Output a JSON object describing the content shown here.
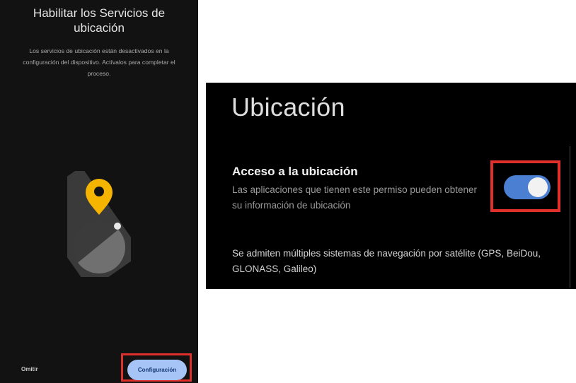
{
  "left_screen": {
    "title_line1": "Habilitar los Servicios de",
    "title_line2": "ubicación",
    "description": "Los servicios de ubicación están desactivados en la configuración del dispositivo. Actívalos para completar el proceso.",
    "skip_label": "Omitir",
    "config_button_label": "Configuración",
    "colors": {
      "pin": "#f5b400",
      "highlight": "#e0302b",
      "button": "#a6c4f5"
    }
  },
  "right_screen": {
    "title": "Ubicación",
    "access_title": "Acceso a la ubicación",
    "access_description": "Las aplicaciones que tienen este permiso pueden obtener su información de ubicación",
    "toggle_state": "on",
    "gnss_note": "Se admiten múltiples sistemas de navegación por satélite (GPS, BeiDou, GLONASS, Galileo)",
    "colors": {
      "toggle_track": "#4a7fd1",
      "highlight": "#e0302b"
    }
  }
}
